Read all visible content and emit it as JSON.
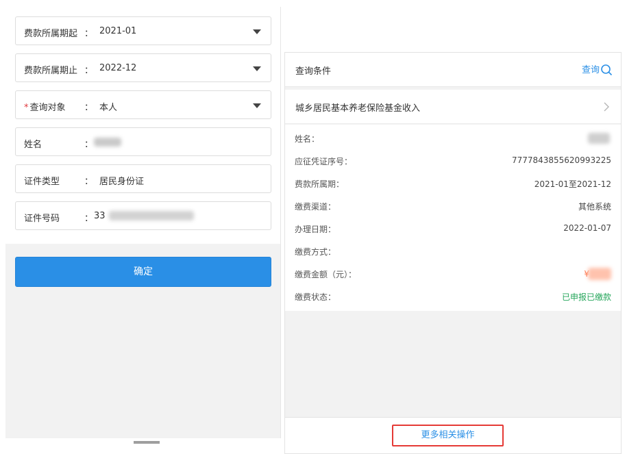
{
  "form": {
    "fields": [
      {
        "label": "费款所属期起",
        "required": false,
        "colon": "：",
        "value": "2021-01",
        "dropdown": true
      },
      {
        "label": "费款所属期止",
        "required": false,
        "colon": "：",
        "value": "2022-12",
        "dropdown": true
      },
      {
        "label": "查询对象",
        "required": true,
        "required_mark": "*",
        "colon": "：",
        "value": "本人",
        "dropdown": true
      },
      {
        "label": "姓名",
        "required": false,
        "colon": "：",
        "value": "",
        "redacted": true
      },
      {
        "label": "证件类型",
        "required": false,
        "colon": "：",
        "value": "居民身份证"
      },
      {
        "label": "证件号码",
        "required": false,
        "colon": "：",
        "value": "33",
        "redacted": true
      }
    ],
    "confirm_label": "确定"
  },
  "result": {
    "header_title": "查询条件",
    "query_label": "查询",
    "category": "城乡居民基本养老保险基金收入",
    "details": [
      {
        "key": "姓名：",
        "value": "",
        "redacted": true
      },
      {
        "key": "应征凭证序号：",
        "value": "7777843855620993225"
      },
      {
        "key": "费款所属期：",
        "value": "2021-01至2021-12"
      },
      {
        "key": "缴费渠道：",
        "value": "其他系统"
      },
      {
        "key": "办理日期：",
        "value": "2022-01-07"
      },
      {
        "key": "缴费方式：",
        "value": ""
      },
      {
        "key": "缴费金额（元）：",
        "value": "¥",
        "redacted": true
      },
      {
        "key": "缴费状态：",
        "value": "已申报已缴款",
        "status": "success"
      }
    ],
    "more_label": "更多相关操作"
  },
  "colors": {
    "accent": "#2a8fe6",
    "success": "#26a65b",
    "required": "#e0393e",
    "highlight_border": "#e53935",
    "amount": "#ff6a3d"
  },
  "icons": [
    "dropdown-caret-icon",
    "search-icon",
    "chevron-right-icon"
  ]
}
